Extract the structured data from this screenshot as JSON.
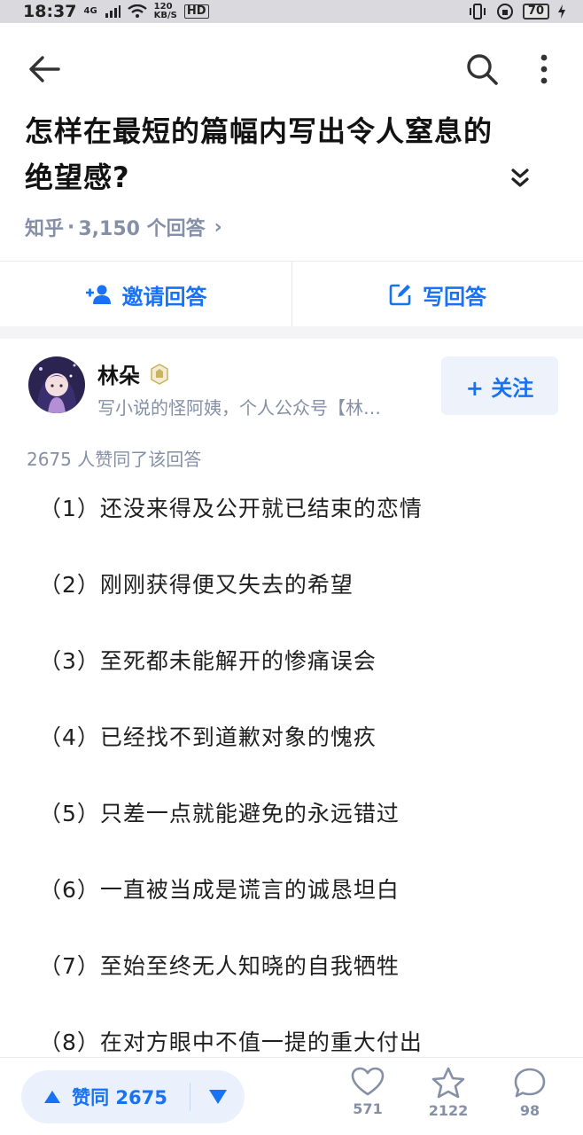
{
  "status_bar": {
    "time": "18:37",
    "network": "4G",
    "speed_value": "120",
    "speed_unit": "KB/S",
    "hd": "HD",
    "battery": "70"
  },
  "question": {
    "title": "怎样在最短的篇幅内写出令人窒息的绝望感?",
    "source": "知乎",
    "separator": "·",
    "answer_count": "3,150 个回答",
    "chevron": "›"
  },
  "actions": {
    "invite_label": "邀请回答",
    "write_label": "写回答"
  },
  "author": {
    "name": "林朵",
    "bio": "写小说的怪阿姨，个人公众号【林…",
    "follow_label": "+ 关注"
  },
  "vote_summary": "2675 人赞同了该回答",
  "answer_lines": [
    "（1）还没来得及公开就已结束的恋情",
    "（2）刚刚获得便又失去的希望",
    "（3）至死都未能解开的惨痛误会",
    "（4）已经找不到道歉对象的愧疚",
    "（5）只差一点就能避免的永远错过",
    "（6）一直被当成是谎言的诚恳坦白",
    "（7）至始至终无人知晓的自我牺牲",
    "（8）在对方眼中不值一提的重大付出"
  ],
  "bottom_bar": {
    "vote_label": "赞同 2675",
    "likes": "571",
    "stars": "2122",
    "comments": "98"
  },
  "colors": {
    "accent": "#1772f6",
    "meta_gray": "#8590a6",
    "follow_bg": "#eef3fb"
  },
  "icons": [
    "back-arrow-icon",
    "search-icon",
    "more-vertical-icon",
    "double-chevron-down-icon",
    "add-user-icon",
    "edit-icon",
    "plus-icon",
    "triangle-up-icon",
    "triangle-down-icon",
    "heart-icon",
    "star-icon",
    "comment-icon"
  ]
}
